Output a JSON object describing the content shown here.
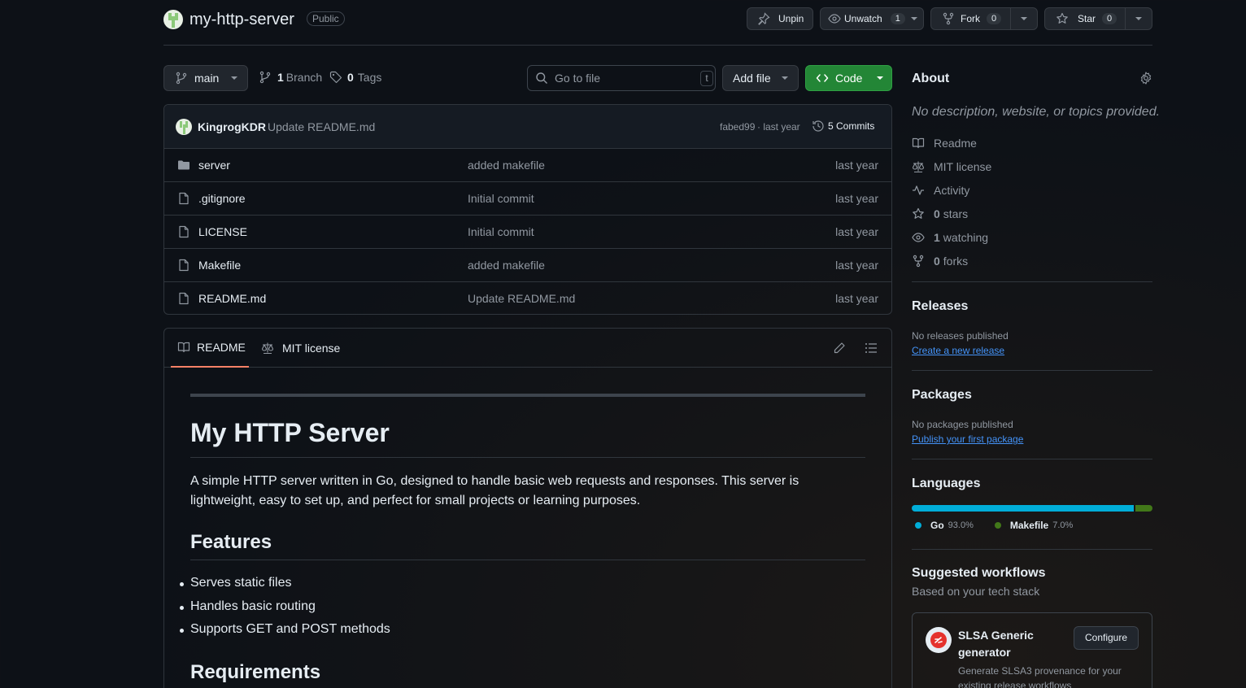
{
  "repo": {
    "name": "my-http-server",
    "visibility": "Public"
  },
  "actions": {
    "unpin": "Unpin",
    "unwatch": "Unwatch",
    "watch_count": "1",
    "fork": "Fork",
    "fork_count": "0",
    "star": "Star",
    "star_count": "0"
  },
  "toolbar": {
    "branch": "main",
    "branch_count": "1",
    "branch_label": "Branch",
    "tag_count": "0",
    "tag_label": "Tags",
    "goto_placeholder": "Go to file",
    "goto_shortcut": "t",
    "add_file": "Add file",
    "code": "Code"
  },
  "commit": {
    "author": "KingrogKDR",
    "message": "Update README.md",
    "hash": "fabed99",
    "time": "· last year",
    "count_label": "5 Commits"
  },
  "files": [
    {
      "name": "server",
      "type": "folder",
      "message": "added makefile",
      "age": "last year"
    },
    {
      "name": ".gitignore",
      "type": "file",
      "message": "Initial commit",
      "age": "last year"
    },
    {
      "name": "LICENSE",
      "type": "file",
      "message": "Initial commit",
      "age": "last year"
    },
    {
      "name": "Makefile",
      "type": "file",
      "message": "added makefile",
      "age": "last year"
    },
    {
      "name": "README.md",
      "type": "file",
      "message": "Update README.md",
      "age": "last year"
    }
  ],
  "readme_tabs": {
    "readme": "README",
    "license": "MIT license"
  },
  "readme": {
    "title": "My HTTP Server",
    "intro": "A simple HTTP server written in Go, designed to handle basic web requests and responses. This server is lightweight, easy to set up, and perfect for small projects or learning purposes.",
    "features_heading": "Features",
    "features": [
      "Serves static files",
      "Handles basic routing",
      "Supports GET and POST methods"
    ],
    "requirements_heading": "Requirements"
  },
  "about": {
    "heading": "About",
    "description": "No description, website, or topics provided.",
    "readme": "Readme",
    "license": "MIT license",
    "activity": "Activity",
    "stars_count": "0",
    "stars_label": "stars",
    "watching_count": "1",
    "watching_label": "watching",
    "forks_count": "0",
    "forks_label": "forks"
  },
  "releases": {
    "heading": "Releases",
    "empty": "No releases published",
    "link": "Create a new release"
  },
  "packages": {
    "heading": "Packages",
    "empty": "No packages published",
    "link": "Publish your first package"
  },
  "languages": {
    "heading": "Languages",
    "items": [
      {
        "name": "Go",
        "percent_label": "93.0%",
        "percent": 93.0,
        "color": "#00ADD8"
      },
      {
        "name": "Makefile",
        "percent_label": "7.0%",
        "percent": 7.0,
        "color": "#427819"
      }
    ]
  },
  "workflows": {
    "heading": "Suggested workflows",
    "subheading": "Based on your tech stack",
    "card_title_1": "SLSA Generic",
    "card_title_2": "generator",
    "configure": "Configure",
    "card_desc_1": "Generate SLSA3 provenance for your",
    "card_desc_2": "existing release workflows"
  },
  "colors": {
    "accent_green": "#238636",
    "link_blue": "#4493f8",
    "tab_underline": "#f78166"
  }
}
